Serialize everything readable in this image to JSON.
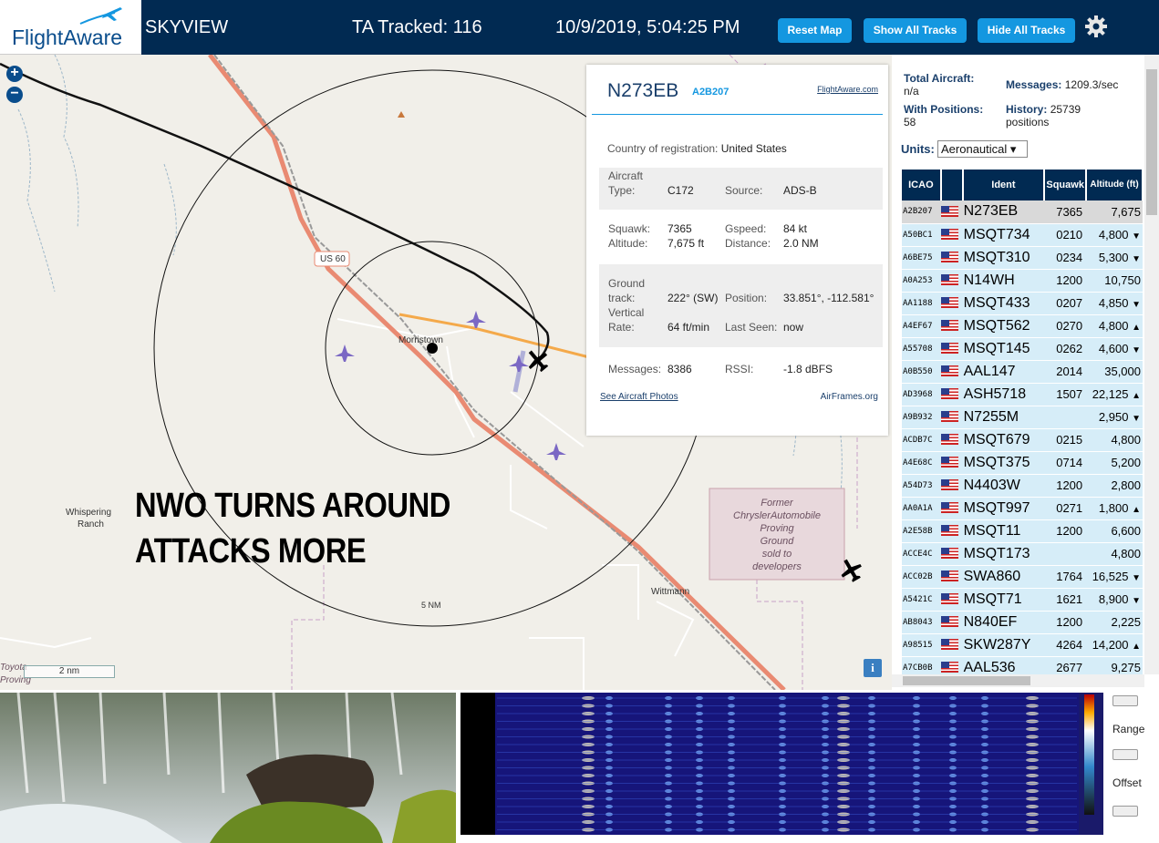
{
  "header": {
    "logo_text": "FlightAware",
    "app_title": "SKYVIEW",
    "ta_tracked": "TA Tracked: 116",
    "datetime": "10/9/2019, 5:04:25 PM",
    "buttons": {
      "reset_map": "Reset Map",
      "show_all": "Show All Tracks",
      "hide_all": "Hide All Tracks"
    }
  },
  "map": {
    "zoom_in": "+",
    "zoom_out": "−",
    "road_shield": "US 60",
    "places": [
      "Morristown",
      "Whispering",
      "Ranch",
      "Wittmann",
      "5 NM"
    ],
    "former_site": [
      "Former",
      "ChryslerAutomobile",
      "Proving",
      "Ground",
      "sold to",
      "developers"
    ],
    "corner_labels": [
      "Toyota",
      "Proving"
    ],
    "overlay_lines": [
      "NWO TURNS AROUND",
      "ATTACKS MORE"
    ],
    "scale": "2 nm",
    "info": "i"
  },
  "popup": {
    "callsign": "N273EB",
    "hex": "A2B207",
    "fa_link": "FlightAware.com",
    "country_label": "Country of registration:",
    "country": "United States",
    "aircraft_type_label": "Aircraft Type:",
    "aircraft_type": "C172",
    "source_label": "Source:",
    "source": "ADS-B",
    "squawk_label": "Squawk:",
    "squawk": "7365",
    "altitude_label": "Altitude:",
    "altitude": "7,675 ft",
    "gspeed_label": "Gspeed:",
    "gspeed": "84 kt",
    "distance_label": "Distance:",
    "distance": "2.0 NM",
    "ground_track_label": "Ground track:",
    "ground_track": "222° (SW)",
    "position_label": "Position:",
    "position": "33.851°, -112.581°",
    "vrate_label": "Vertical Rate:",
    "vrate": "64 ft/min",
    "last_seen_label": "Last Seen:",
    "last_seen": "now",
    "messages_label": "Messages:",
    "messages": "8386",
    "rssi_label": "RSSI:",
    "rssi": "-1.8 dBFS",
    "photos_link": "See Aircraft Photos",
    "airframes_link": "AirFrames.org"
  },
  "panel": {
    "total_aircraft_label": "Total Aircraft:",
    "total_aircraft": "n/a",
    "with_positions_label": "With Positions:",
    "with_positions": "58",
    "messages_label": "Messages:",
    "messages": "1209.3/sec",
    "history_label": "History:",
    "history": "25739",
    "history_unit": "positions",
    "units_label": "Units:",
    "units_value": "Aeronautical ▾",
    "columns": [
      "ICAO",
      "",
      "Ident",
      "Squawk",
      "Altitude (ft)"
    ],
    "rows": [
      {
        "icao": "A2B207",
        "ident": "N273EB",
        "squawk": "7365",
        "alt": "7,675",
        "trend": ""
      },
      {
        "icao": "A50BC1",
        "ident": "MSQT734",
        "squawk": "0210",
        "alt": "4,800",
        "trend": "▼"
      },
      {
        "icao": "A6BE75",
        "ident": "MSQT310",
        "squawk": "0234",
        "alt": "5,300",
        "trend": "▼"
      },
      {
        "icao": "A0A253",
        "ident": "N14WH",
        "squawk": "1200",
        "alt": "10,750",
        "trend": ""
      },
      {
        "icao": "AA1188",
        "ident": "MSQT433",
        "squawk": "0207",
        "alt": "4,850",
        "trend": "▼"
      },
      {
        "icao": "A4EF67",
        "ident": "MSQT562",
        "squawk": "0270",
        "alt": "4,800",
        "trend": "▲"
      },
      {
        "icao": "A55708",
        "ident": "MSQT145",
        "squawk": "0262",
        "alt": "4,600",
        "trend": "▼"
      },
      {
        "icao": "A0B550",
        "ident": "AAL147",
        "squawk": "2014",
        "alt": "35,000",
        "trend": ""
      },
      {
        "icao": "AD3968",
        "ident": "ASH5718",
        "squawk": "1507",
        "alt": "22,125",
        "trend": "▲"
      },
      {
        "icao": "A9B932",
        "ident": "N7255M",
        "squawk": "",
        "alt": "2,950",
        "trend": "▼"
      },
      {
        "icao": "ACDB7C",
        "ident": "MSQT679",
        "squawk": "0215",
        "alt": "4,800",
        "trend": ""
      },
      {
        "icao": "A4E68C",
        "ident": "MSQT375",
        "squawk": "0714",
        "alt": "5,200",
        "trend": ""
      },
      {
        "icao": "A54D73",
        "ident": "N4403W",
        "squawk": "1200",
        "alt": "2,800",
        "trend": ""
      },
      {
        "icao": "AA0A1A",
        "ident": "MSQT997",
        "squawk": "0271",
        "alt": "1,800",
        "trend": "▲"
      },
      {
        "icao": "A2E58B",
        "ident": "MSQT11",
        "squawk": "1200",
        "alt": "6,600",
        "trend": ""
      },
      {
        "icao": "ACCE4C",
        "ident": "MSQT173",
        "squawk": "",
        "alt": "4,800",
        "trend": ""
      },
      {
        "icao": "ACC02B",
        "ident": "SWA860",
        "squawk": "1764",
        "alt": "16,525",
        "trend": "▼"
      },
      {
        "icao": "A5421C",
        "ident": "MSQT71",
        "squawk": "1621",
        "alt": "8,900",
        "trend": "▼"
      },
      {
        "icao": "AB8043",
        "ident": "N840EF",
        "squawk": "1200",
        "alt": "2,225",
        "trend": ""
      },
      {
        "icao": "A98515",
        "ident": "SKW287Y",
        "squawk": "4264",
        "alt": "14,200",
        "trend": "▲"
      },
      {
        "icao": "A7CB0B",
        "ident": "AAL536",
        "squawk": "2677",
        "alt": "9,275",
        "trend": ""
      }
    ]
  },
  "spectrum": {
    "range_label": "Range",
    "offset_label": "Offset"
  },
  "colors": {
    "header_bg": "#012a52",
    "button": "#1497e0",
    "row_bg": "#d6edf8",
    "selected_row": "#d9d9d9"
  }
}
